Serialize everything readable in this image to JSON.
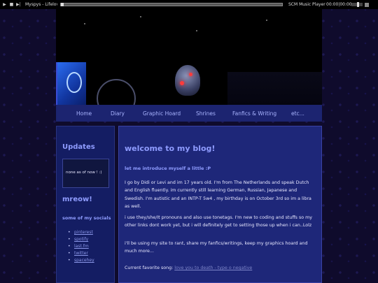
{
  "player": {
    "buttons": [
      "play-icon",
      "stop-icon",
      "next-icon"
    ],
    "now_playing": "Myspys - Lifelover",
    "player_name": "SCM Music Player",
    "time": "00:00|00:00"
  },
  "nav": {
    "items": [
      "Home",
      "Diary",
      "Graphic Hoard",
      "Shrines",
      "Fanfics & Writing",
      "etc..."
    ]
  },
  "sidebar": {
    "updates_title": "Updates",
    "updates_text": "none as of now ! :)",
    "mreow_title": "mreow!",
    "socials_title": "some of my socials",
    "socials": [
      "pinterest",
      "spotify",
      "last.fm",
      "twitter",
      "spacehey"
    ]
  },
  "main": {
    "title": "welcome to my blog!",
    "subtitle": "let me introduce myself a little :P",
    "para1": "I go by Didi or Levi and im 17 years old. I'm from The Netherlands and speak Dutch and English fluently. im currently still learning German, Russian, Japanese and Swedish. I'm autistic and an INTP-T 5w4 , my birthday is on October 3rd so im a libra as well.",
    "para2": "i use they/she/It pronouns and also use tonetags. I'm new to coding and stuffs so my other links dont work yet, but i will definitely get to setting those up when i can..Lolz",
    "para3": "i'll be using my site to rant, share my fanfics/writings, keep my graphics hoard and much more...",
    "song_label": "Current favorite song: ",
    "song_link": "love you to death - type o negative"
  },
  "colors": {
    "background": "#0f0b2c",
    "nav": "#1c2470",
    "panel": "#1e2779",
    "heading": "#8f9cff",
    "text": "#e8e8ff"
  }
}
